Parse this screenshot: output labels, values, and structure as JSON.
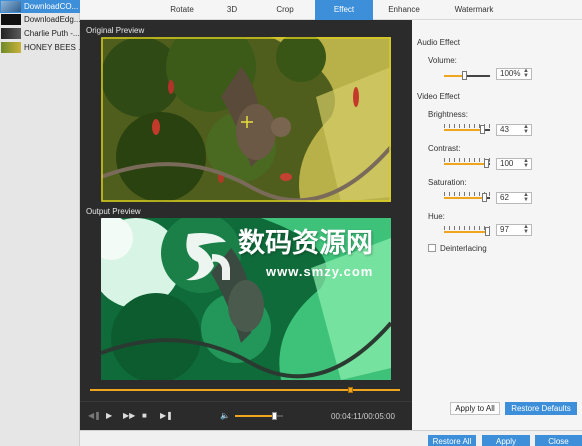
{
  "files": [
    {
      "name": "DownloadCO...",
      "selected": true
    },
    {
      "name": "DownloadEdg...",
      "selected": false
    },
    {
      "name": "Charlie Puth -...",
      "selected": false
    },
    {
      "name": "HONEY BEES ...",
      "selected": false
    }
  ],
  "tabs": [
    "Rotate",
    "3D",
    "Crop",
    "Effect",
    "Enhance",
    "Watermark"
  ],
  "active_tab": "Effect",
  "preview": {
    "original_label": "Original Preview",
    "output_label": "Output Preview",
    "watermark_cn": "数码资源网",
    "watermark_url": "www.smzy.com",
    "progress_fraction": 0.845
  },
  "playback": {
    "time": "00:04:11/00:05:00",
    "volume_fraction": 0.85
  },
  "audio": {
    "section_label": "Audio Effect",
    "volume_label": "Volume:",
    "volume_value": "100%",
    "volume_fraction": 0.45
  },
  "video": {
    "section_label": "Video Effect",
    "brightness_label": "Brightness:",
    "brightness_value": "43",
    "contrast_label": "Contrast:",
    "contrast_value": "100",
    "saturation_label": "Saturation:",
    "saturation_value": "62",
    "hue_label": "Hue:",
    "hue_value": "97",
    "deinterlacing_label": "Deinterlacing"
  },
  "buttons": {
    "apply_to_all": "Apply to All",
    "restore_defaults": "Restore Defaults",
    "restore_all": "Restore All",
    "apply": "Apply",
    "close": "Close"
  },
  "colors": {
    "accent": "#3d8fd9",
    "slider_fill": "#f0a51f",
    "crop_border": "#d9cc1f"
  },
  "icons": {
    "prev": "skip-back-icon",
    "play": "play-icon",
    "next": "fast-forward-icon",
    "stop": "stop-icon",
    "end": "skip-end-icon",
    "volume": "speaker-icon"
  }
}
